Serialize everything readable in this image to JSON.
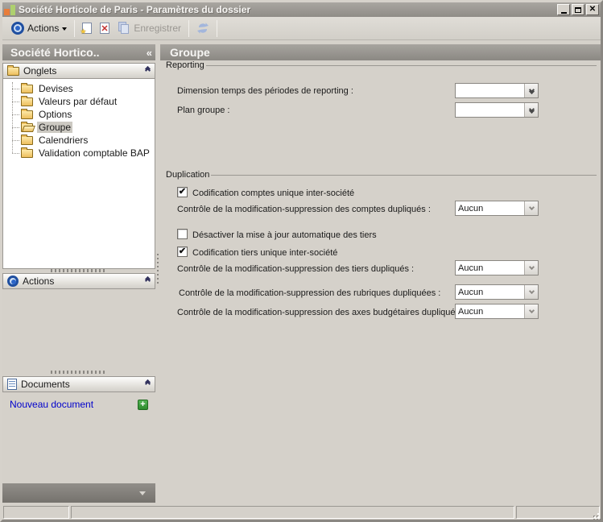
{
  "window": {
    "title": "Société Horticole de Paris -  Paramètres du dossier"
  },
  "toolbar": {
    "actions_label": "Actions",
    "save_label": "Enregistrer"
  },
  "sidebar": {
    "header_title": "Société Hortico..",
    "collapse_glyph": "«",
    "onglets": {
      "title": "Onglets",
      "items": [
        {
          "label": "Devises"
        },
        {
          "label": "Valeurs par défaut"
        },
        {
          "label": "Options"
        },
        {
          "label": "Groupe",
          "selected": true
        },
        {
          "label": "Calendriers"
        },
        {
          "label": "Validation comptable BAP"
        }
      ],
      "selected_item": "Groupe"
    },
    "actions_panel": {
      "title": "Actions"
    },
    "documents_panel": {
      "title": "Documents",
      "new_link": "Nouveau document",
      "plus_glyph": "+"
    }
  },
  "main": {
    "header_title": "Groupe",
    "reporting": {
      "title": "Reporting",
      "rows": [
        {
          "label": "Dimension temps des périodes de reporting :",
          "value": ""
        },
        {
          "label": "Plan groupe :",
          "value": ""
        }
      ]
    },
    "duplication": {
      "title": "Duplication",
      "checkboxes": [
        {
          "label": "Codification comptes unique inter-société",
          "checked": true,
          "glyph": "✔"
        },
        {
          "label": "Désactiver la mise à jour automatique des tiers",
          "checked": false,
          "glyph": ""
        },
        {
          "label": "Codification tiers unique inter-société",
          "checked": true,
          "glyph": "✔"
        }
      ],
      "controls": [
        {
          "label": "Contrôle de la modification-suppression des comptes dupliqués :",
          "value": "Aucun"
        },
        {
          "label": "Contrôle de la modification-suppression des tiers dupliqués :",
          "value": "Aucun"
        },
        {
          "label": "Contrôle de la modification-suppression des rubriques dupliquées :",
          "value": "Aucun"
        },
        {
          "label": "Contrôle de la modification-suppression des axes budgétaires dupliqués :",
          "value": "Aucun"
        }
      ]
    }
  },
  "colors": {
    "window_bg": "#d5d1ca",
    "titlebar_gray": "#9b9894",
    "panel_header_gray": "#928f8a",
    "link_blue": "#0000cc",
    "folder_yellow": "#edbf5e",
    "plus_green": "#2e8a2e",
    "target_blue": "#1f4fa0",
    "delete_red": "#c23030"
  }
}
